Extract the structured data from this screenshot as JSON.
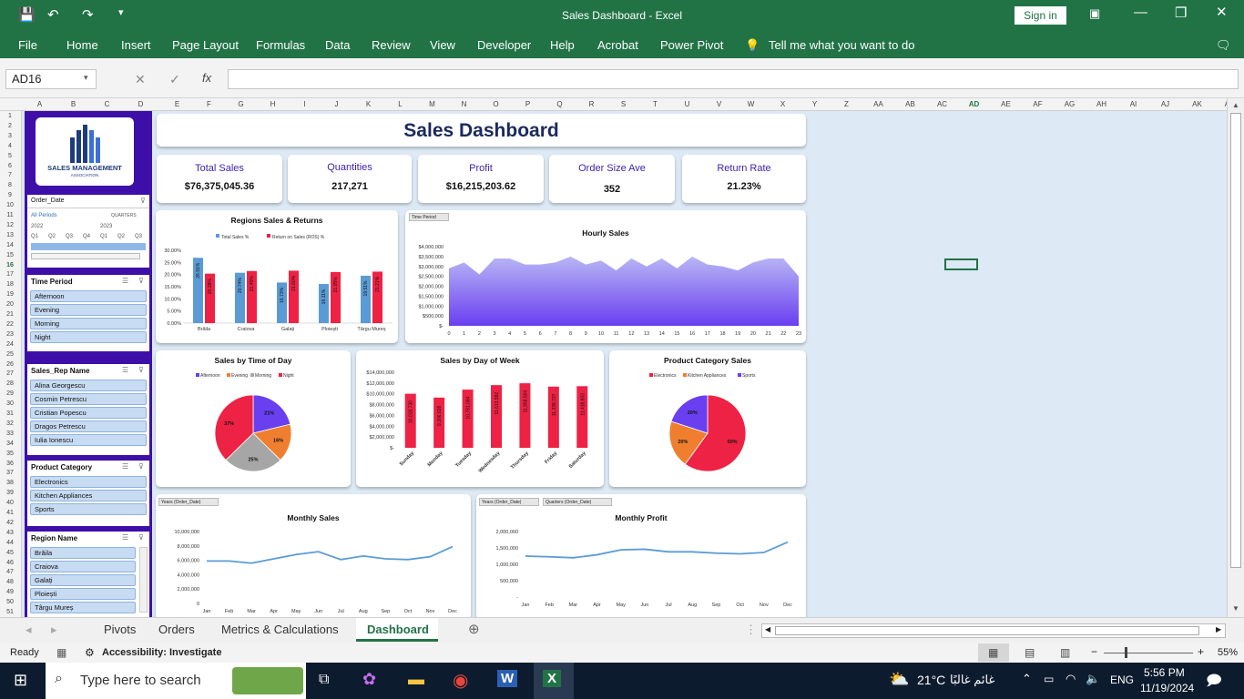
{
  "window": {
    "title": "Sales Dashboard  -  Excel",
    "sign_in": "Sign in"
  },
  "ribbon": {
    "tabs": [
      "File",
      "Home",
      "Insert",
      "Page Layout",
      "Formulas",
      "Data",
      "Review",
      "View",
      "Developer",
      "Help",
      "Acrobat",
      "Power Pivot"
    ],
    "tell_me": "Tell me what you want to do"
  },
  "formula_bar": {
    "name_box": "AD16",
    "formula": ""
  },
  "columns": [
    "A",
    "B",
    "C",
    "D",
    "E",
    "F",
    "G",
    "H",
    "I",
    "J",
    "K",
    "L",
    "M",
    "N",
    "O",
    "P",
    "Q",
    "R",
    "S",
    "T",
    "U",
    "V",
    "W",
    "X",
    "Y",
    "Z",
    "AA",
    "AB",
    "AC",
    "AD",
    "AE",
    "AF",
    "AG",
    "AH",
    "AI",
    "AJ",
    "AK",
    "AL"
  ],
  "logo": {
    "line1": "SALES MANAGEMENT",
    "line2": "ASSOCIATION"
  },
  "slicers": {
    "order_date": {
      "title": "Order_Date",
      "all_periods": "All Periods",
      "level": "QUARTERS",
      "years": [
        "2022",
        "2023"
      ],
      "quarters": [
        "Q1",
        "Q2",
        "Q3",
        "Q4",
        "Q1",
        "Q2",
        "Q3"
      ]
    },
    "time_period": {
      "title": "Time Period",
      "items": [
        "Afternoon",
        "Evening",
        "Morning",
        "Night"
      ]
    },
    "sales_rep": {
      "title": "Sales_Rep Name",
      "items": [
        "Alina Georgescu",
        "Cosmin Petrescu",
        "Cristian Popescu",
        "Dragos Petrescu",
        "Iulia Ionescu"
      ]
    },
    "product_category": {
      "title": "Product Category",
      "items": [
        "Electronics",
        "Kitchen Appliances",
        "Sports"
      ]
    },
    "region": {
      "title": "Region Name",
      "items": [
        "Brăila",
        "Craiova",
        "Galați",
        "Ploiești",
        "Târgu Mureș"
      ]
    }
  },
  "dashboard": {
    "title": "Sales Dashboard"
  },
  "kpis": [
    {
      "label": "Total Sales",
      "value": "$76,375,045.36"
    },
    {
      "label": "Quantities",
      "value": "217,271"
    },
    {
      "label": "Profit",
      "value": "$16,215,203.62"
    },
    {
      "label": "Order Size Ave",
      "value": "352"
    },
    {
      "label": "Return Rate",
      "value": "21.23%"
    }
  ],
  "filters": {
    "time_period": "Time Period",
    "years": "Years (Order_Date)",
    "quarters": "Quarters (Order_Date)"
  },
  "chart_data": [
    {
      "type": "bar",
      "title": "Regions Sales & Returns",
      "categories": [
        "Brăila",
        "Craiova",
        "Galați",
        "Ploiești",
        "Târgu Mureș"
      ],
      "series": [
        {
          "name": "Total Sales %",
          "color": "#5b9bd5",
          "values": [
            26.91,
            20.74,
            16.73,
            16.11,
            19.51
          ],
          "labels": [
            "26.91%",
            "20.74%",
            "16.73%",
            "16.11%",
            "19.51%"
          ]
        },
        {
          "name": "Return on Sales (ROS) %",
          "color": "#ee2244",
          "values": [
            20.38,
            21.45,
            21.6,
            21.05,
            21.21
          ],
          "labels": [
            "20.38%",
            "21.45%",
            "21.60%",
            "21.05%",
            "21.21%"
          ]
        }
      ],
      "yticks": [
        "30.00%",
        "25.00%",
        "20.00%",
        "15.00%",
        "10.00%",
        "5.00%",
        "0.00%"
      ],
      "ylim": [
        0,
        30
      ],
      "legend": "top"
    },
    {
      "type": "area",
      "title": "Hourly Sales",
      "x": [
        0,
        1,
        2,
        3,
        4,
        5,
        6,
        7,
        8,
        9,
        10,
        11,
        12,
        13,
        14,
        15,
        16,
        17,
        18,
        19,
        20,
        21,
        22,
        23
      ],
      "values": [
        2900000,
        3200000,
        2600000,
        3400000,
        3400000,
        3100000,
        3100000,
        3200000,
        3500000,
        3100000,
        3300000,
        2800000,
        3400000,
        3000000,
        3400000,
        2900000,
        3500000,
        3100000,
        3000000,
        2800000,
        3200000,
        3400000,
        3400000,
        2500000
      ],
      "yticks": [
        "$4,000,000",
        "$3,500,000",
        "$3,000,000",
        "$2,500,000",
        "$2,000,000",
        "$1,500,000",
        "$1,000,000",
        "$500,000",
        "$-"
      ],
      "ylim": [
        0,
        4000000
      ]
    },
    {
      "type": "pie",
      "title": "Sales by Time of Day",
      "categories": [
        "Afternoon",
        "Evening",
        "Morning",
        "Night"
      ],
      "values": [
        21,
        16,
        25,
        37
      ],
      "labels": [
        "21%",
        "16%",
        "25%",
        "37%"
      ],
      "colors": [
        "#6a3ff0",
        "#ef7f2f",
        "#a6a6a6",
        "#ee2244"
      ],
      "legend": "top"
    },
    {
      "type": "bar",
      "title": "Sales by Day of Week",
      "categories": [
        "Sunday",
        "Monday",
        "Tuesday",
        "Wednesday",
        "Thursday",
        "Friday",
        "Saturday"
      ],
      "values": [
        10018730,
        9306626,
        10781084,
        11613592,
        11958504,
        11338727,
        11418803
      ],
      "labels": [
        "10,018,730",
        "9,306,626",
        "10,781,084",
        "11,613,592",
        "11,958,504",
        "11,338,727",
        "11,418,803"
      ],
      "yticks": [
        "$14,000,000",
        "$12,000,000",
        "$10,000,000",
        "$8,000,000",
        "$6,000,000",
        "$4,000,000",
        "$2,000,000",
        "$-"
      ],
      "ylim": [
        0,
        14000000
      ],
      "color": "#ee2244"
    },
    {
      "type": "pie",
      "title": "Product Category Sales",
      "categories": [
        "Electronics",
        "Kitchen Appliances",
        "Sports"
      ],
      "values": [
        60,
        20,
        20
      ],
      "labels": [
        "60%",
        "20%",
        "20%"
      ],
      "colors": [
        "#ee2244",
        "#ef7f2f",
        "#6a3ff0"
      ],
      "legend": "top"
    },
    {
      "type": "line",
      "title": "Monthly Sales",
      "x": [
        "Jan",
        "Feb",
        "Mar",
        "Apr",
        "May",
        "Jun",
        "Jul",
        "Aug",
        "Sep",
        "Oct",
        "Nov",
        "Dec"
      ],
      "values": [
        5900000,
        5900000,
        5600000,
        6200000,
        6800000,
        7200000,
        6100000,
        6600000,
        6200000,
        6100000,
        6500000,
        7900000
      ],
      "yticks": [
        "10,000,000",
        "8,000,000",
        "6,000,000",
        "4,000,000",
        "2,000,000",
        "0"
      ],
      "ylim": [
        0,
        10000000
      ]
    },
    {
      "type": "line",
      "title": "Monthly Profit",
      "x": [
        "Jan",
        "Feb",
        "Mar",
        "Apr",
        "May",
        "Jun",
        "Jul",
        "Aug",
        "Sep",
        "Oct",
        "Nov",
        "Dec"
      ],
      "values": [
        1250000,
        1230000,
        1200000,
        1290000,
        1440000,
        1460000,
        1380000,
        1380000,
        1340000,
        1320000,
        1360000,
        1680000
      ],
      "yticks": [
        "2,000,000",
        "1,500,000",
        "1,000,000",
        "500,000",
        "-"
      ],
      "ylim": [
        0,
        2000000
      ]
    }
  ],
  "sheet_tabs": [
    "Pivots",
    "Orders",
    "Metrics & Calculations",
    "Dashboard"
  ],
  "active_tab": "Dashboard",
  "status": {
    "ready": "Ready",
    "accessibility": "Accessibility: Investigate",
    "zoom": "55%"
  },
  "taskbar": {
    "search_placeholder": "Type here to search",
    "temperature": "21°C",
    "weather": "غائم غالبًا",
    "lang": "ENG",
    "time": "5:56 PM",
    "date": "11/19/2024"
  }
}
